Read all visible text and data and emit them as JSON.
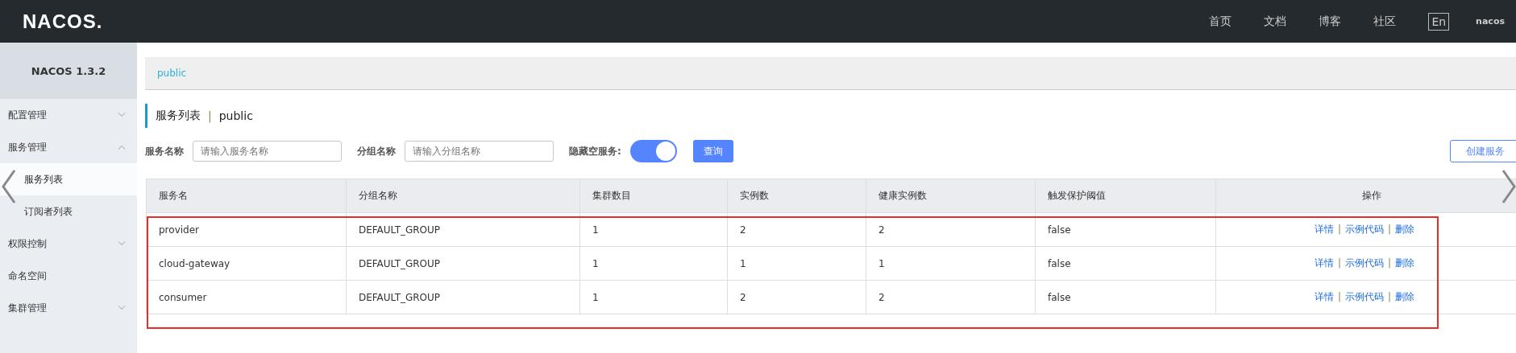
{
  "header": {
    "logo": "NACOS.",
    "nav": [
      "首页",
      "文档",
      "博客",
      "社区"
    ],
    "language": "En",
    "user": "nacos"
  },
  "sidebar": {
    "title": "NACOS 1.3.2",
    "items": [
      {
        "label": "配置管理",
        "expandable": true,
        "expanded": false
      },
      {
        "label": "服务管理",
        "expandable": true,
        "expanded": true,
        "children": [
          {
            "label": "服务列表",
            "selected": true
          },
          {
            "label": "订阅者列表",
            "selected": false
          }
        ]
      },
      {
        "label": "权限控制",
        "expandable": true,
        "expanded": false
      },
      {
        "label": "命名空间",
        "expandable": false,
        "expanded": false
      },
      {
        "label": "集群管理",
        "expandable": true,
        "expanded": false
      }
    ]
  },
  "namespace_bar": {
    "namespace": "public"
  },
  "page_title": {
    "title": "服务列表",
    "separator": "|",
    "namespace": "public"
  },
  "filters": {
    "service_label": "服务名称",
    "service_placeholder": "请输入服务名称",
    "group_label": "分组名称",
    "group_placeholder": "请输入分组名称",
    "hide_empty_label": "隐藏空服务:",
    "hide_empty_on": true,
    "query_button": "查询",
    "create_button": "创建服务"
  },
  "table": {
    "columns": [
      "服务名",
      "分组名称",
      "集群数目",
      "实例数",
      "健康实例数",
      "触发保护阈值",
      "操作"
    ],
    "action_separator": "|",
    "rows": [
      {
        "cells": [
          "provider",
          "DEFAULT_GROUP",
          "1",
          "2",
          "2",
          "false"
        ],
        "actions": [
          "详情",
          "示例代码",
          "删除"
        ]
      },
      {
        "cells": [
          "cloud-gateway",
          "DEFAULT_GROUP",
          "1",
          "1",
          "1",
          "false"
        ],
        "actions": [
          "详情",
          "示例代码",
          "删除"
        ]
      },
      {
        "cells": [
          "consumer",
          "DEFAULT_GROUP",
          "1",
          "2",
          "2",
          "false"
        ],
        "actions": [
          "详情",
          "示例代码",
          "删除"
        ]
      }
    ]
  }
}
